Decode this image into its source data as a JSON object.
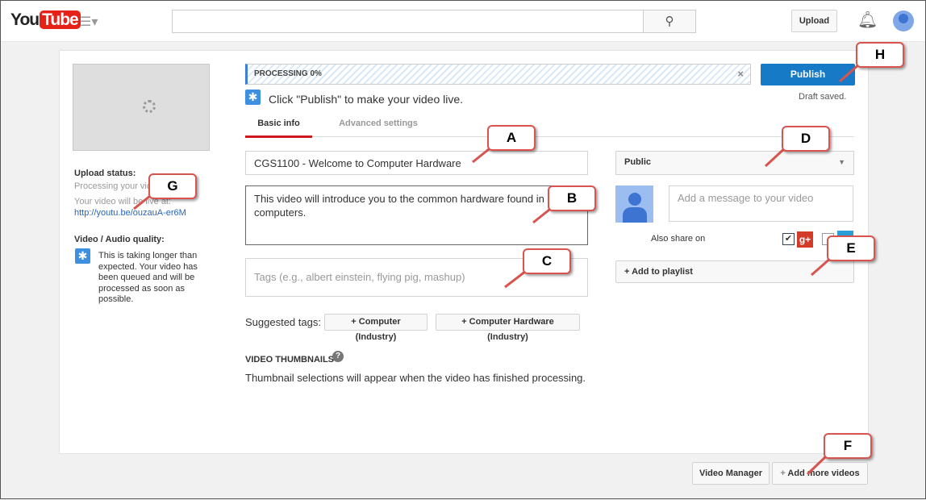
{
  "header": {
    "logo": "YouTube",
    "logo_you": "You",
    "logo_tube": "Tube",
    "search_placeholder": "",
    "upload": "Upload"
  },
  "sidebar": {
    "upload_status_label": "Upload status:",
    "processing": "Processing your video...",
    "will_be_live": "Your video will be live at:",
    "url": "http://youtu.be/ouzauA-er6M",
    "quality_label": "Video / Audio quality:",
    "quality_msg": "This is taking longer than expected. Your video has been queued and will be processed as soon as possible."
  },
  "progress": {
    "label": "PROCESSING 0%",
    "percent": 0
  },
  "publish": "Publish",
  "draft": "Draft saved.",
  "hint": "Click \"Publish\" to make your video live.",
  "tabs": [
    "Basic info",
    "Advanced settings"
  ],
  "form": {
    "title": "CGS1100 - Welcome to Computer Hardware",
    "description": "This video will introduce you to the common hardware found in most computers.",
    "tags_placeholder": "Tags (e.g., albert einstein, flying pig, mashup)",
    "suggested_label": "Suggested tags:",
    "suggested": [
      "+ Computer (Industry)",
      "+ Computer Hardware (Industry)"
    ],
    "thumb_heading": "VIDEO THUMBNAILS",
    "thumb_msg": "Thumbnail selections will appear when the video has finished processing."
  },
  "privacy": "Public",
  "message_placeholder": "Add a message to your video",
  "share_label": "Also share on",
  "playlist": "+ Add to playlist",
  "footer": {
    "video_manager": "Video Manager",
    "add_more": "Add more videos"
  },
  "callouts": [
    "A",
    "B",
    "C",
    "D",
    "E",
    "F",
    "G",
    "H"
  ],
  "colors": {
    "accent": "#167ac6",
    "callout_border": "#d9534f",
    "youtube_red": "#e62117"
  }
}
